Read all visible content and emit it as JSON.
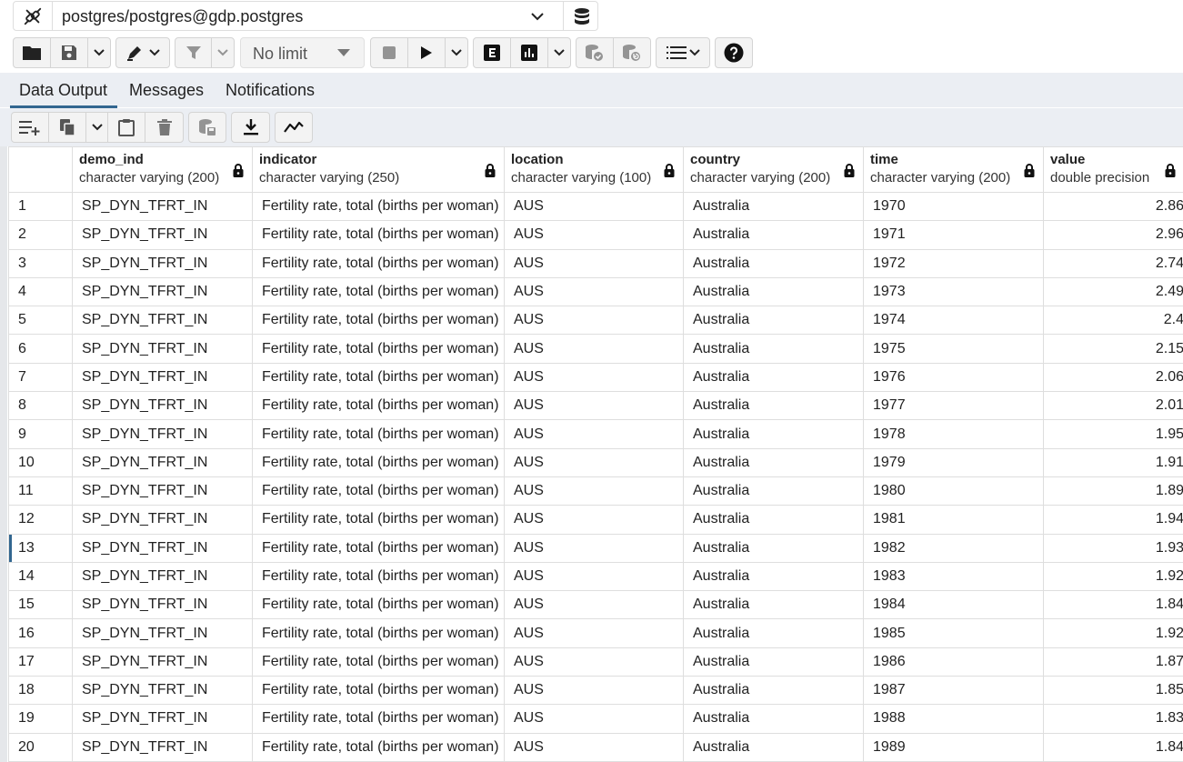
{
  "connection": {
    "label": "postgres/postgres@gdp.postgres"
  },
  "toolbar": {
    "limit_label": "No limit",
    "icons": [
      "folder-icon",
      "save-icon",
      "chevron-down-icon",
      "edit-icon",
      "filter-icon",
      "stop-icon",
      "play-icon",
      "explain-icon",
      "explain-analyze-icon",
      "commit-icon",
      "rollback-icon",
      "macros-icon",
      "help-icon"
    ]
  },
  "tabs": [
    {
      "label": "Data Output",
      "active": true
    },
    {
      "label": "Messages",
      "active": false
    },
    {
      "label": "Notifications",
      "active": false
    }
  ],
  "grid": {
    "columns": [
      {
        "name": "demo_ind",
        "type": "character varying (200)"
      },
      {
        "name": "indicator",
        "type": "character varying (250)"
      },
      {
        "name": "location",
        "type": "character varying (100)"
      },
      {
        "name": "country",
        "type": "character varying (200)"
      },
      {
        "name": "time",
        "type": "character varying (200)"
      },
      {
        "name": "value",
        "type": "double precision"
      }
    ],
    "rows": [
      [
        "1",
        "SP_DYN_TFRT_IN",
        "Fertility rate, total (births per woman)",
        "AUS",
        "Australia",
        "1970",
        "2.86"
      ],
      [
        "2",
        "SP_DYN_TFRT_IN",
        "Fertility rate, total (births per woman)",
        "AUS",
        "Australia",
        "1971",
        "2.96"
      ],
      [
        "3",
        "SP_DYN_TFRT_IN",
        "Fertility rate, total (births per woman)",
        "AUS",
        "Australia",
        "1972",
        "2.74"
      ],
      [
        "4",
        "SP_DYN_TFRT_IN",
        "Fertility rate, total (births per woman)",
        "AUS",
        "Australia",
        "1973",
        "2.49"
      ],
      [
        "5",
        "SP_DYN_TFRT_IN",
        "Fertility rate, total (births per woman)",
        "AUS",
        "Australia",
        "1974",
        "2.4"
      ],
      [
        "6",
        "SP_DYN_TFRT_IN",
        "Fertility rate, total (births per woman)",
        "AUS",
        "Australia",
        "1975",
        "2.15"
      ],
      [
        "7",
        "SP_DYN_TFRT_IN",
        "Fertility rate, total (births per woman)",
        "AUS",
        "Australia",
        "1976",
        "2.06"
      ],
      [
        "8",
        "SP_DYN_TFRT_IN",
        "Fertility rate, total (births per woman)",
        "AUS",
        "Australia",
        "1977",
        "2.01"
      ],
      [
        "9",
        "SP_DYN_TFRT_IN",
        "Fertility rate, total (births per woman)",
        "AUS",
        "Australia",
        "1978",
        "1.95"
      ],
      [
        "10",
        "SP_DYN_TFRT_IN",
        "Fertility rate, total (births per woman)",
        "AUS",
        "Australia",
        "1979",
        "1.91"
      ],
      [
        "11",
        "SP_DYN_TFRT_IN",
        "Fertility rate, total (births per woman)",
        "AUS",
        "Australia",
        "1980",
        "1.89"
      ],
      [
        "12",
        "SP_DYN_TFRT_IN",
        "Fertility rate, total (births per woman)",
        "AUS",
        "Australia",
        "1981",
        "1.94"
      ],
      [
        "13",
        "SP_DYN_TFRT_IN",
        "Fertility rate, total (births per woman)",
        "AUS",
        "Australia",
        "1982",
        "1.93"
      ],
      [
        "14",
        "SP_DYN_TFRT_IN",
        "Fertility rate, total (births per woman)",
        "AUS",
        "Australia",
        "1983",
        "1.92"
      ],
      [
        "15",
        "SP_DYN_TFRT_IN",
        "Fertility rate, total (births per woman)",
        "AUS",
        "Australia",
        "1984",
        "1.84"
      ],
      [
        "16",
        "SP_DYN_TFRT_IN",
        "Fertility rate, total (births per woman)",
        "AUS",
        "Australia",
        "1985",
        "1.92"
      ],
      [
        "17",
        "SP_DYN_TFRT_IN",
        "Fertility rate, total (births per woman)",
        "AUS",
        "Australia",
        "1986",
        "1.87"
      ],
      [
        "18",
        "SP_DYN_TFRT_IN",
        "Fertility rate, total (births per woman)",
        "AUS",
        "Australia",
        "1987",
        "1.85"
      ],
      [
        "19",
        "SP_DYN_TFRT_IN",
        "Fertility rate, total (births per woman)",
        "AUS",
        "Australia",
        "1988",
        "1.83"
      ],
      [
        "20",
        "SP_DYN_TFRT_IN",
        "Fertility rate, total (births per woman)",
        "AUS",
        "Australia",
        "1989",
        "1.84"
      ]
    ],
    "selected_row": 13
  },
  "colors": {
    "accent": "#326690",
    "tab_bar_bg": "#ebeef3",
    "border": "#dedede"
  }
}
